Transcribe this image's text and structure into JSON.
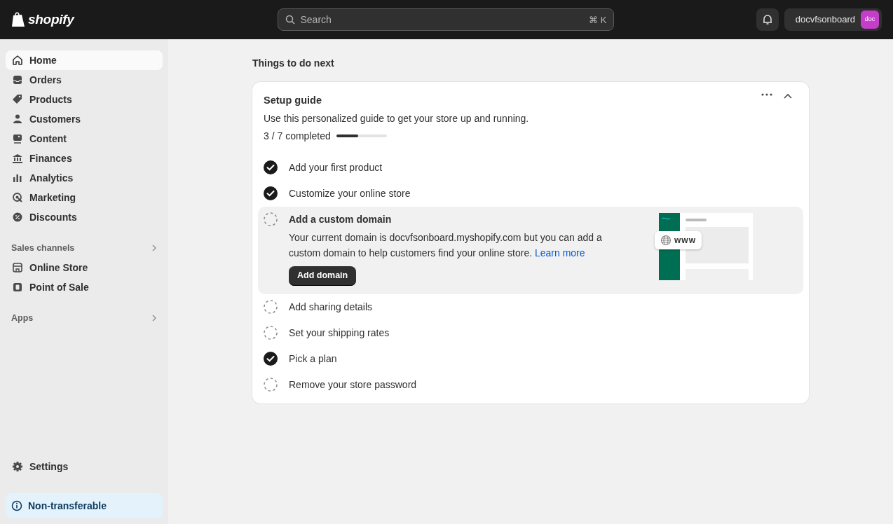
{
  "topbar": {
    "logo": "shopify",
    "search": {
      "placeholder": "Search",
      "shortcut": "⌘ K"
    },
    "store_name": "docvfsonboard",
    "avatar": "doc"
  },
  "sidebar": {
    "items": [
      {
        "label": "Home",
        "selected": true
      },
      {
        "label": "Orders",
        "selected": false
      },
      {
        "label": "Products",
        "selected": false
      },
      {
        "label": "Customers",
        "selected": false
      },
      {
        "label": "Content",
        "selected": false
      },
      {
        "label": "Finances",
        "selected": false
      },
      {
        "label": "Analytics",
        "selected": false
      },
      {
        "label": "Marketing",
        "selected": false
      },
      {
        "label": "Discounts",
        "selected": false
      }
    ],
    "sections": [
      {
        "title": "Sales channels",
        "items": [
          {
            "label": "Online Store",
            "selected": false
          },
          {
            "label": "Point of Sale",
            "selected": false
          }
        ]
      },
      {
        "title": "Apps"
      }
    ],
    "settings": "Settings",
    "notice": "Non-transferable"
  },
  "main": {
    "heading": "Things to do next",
    "setup_guide": {
      "title": "Setup guide",
      "subtitle": "Use this personalized guide to get your store up and running.",
      "progress_text": "3 / 7 completed",
      "level": 0.43,
      "tasks": [
        {
          "title": "Add your first product",
          "done": true,
          "expanded": false
        },
        {
          "title": "Customize your online store",
          "done": true,
          "expanded": false
        },
        {
          "title": "Add a custom domain",
          "done": false,
          "expanded": true,
          "description": "Your current domain is docvfsonboard.myshopify.com but you can add a custom domain to help customers find your online store.",
          "link": "Learn more",
          "button": "Add domain",
          "illustration_label": "www"
        },
        {
          "title": "Add sharing details",
          "done": false,
          "expanded": false
        },
        {
          "title": "Set your shipping rates",
          "done": false,
          "expanded": false
        },
        {
          "title": "Pick a plan",
          "done": true,
          "expanded": false
        },
        {
          "title": "Remove your store password",
          "done": false,
          "expanded": false
        }
      ]
    }
  }
}
